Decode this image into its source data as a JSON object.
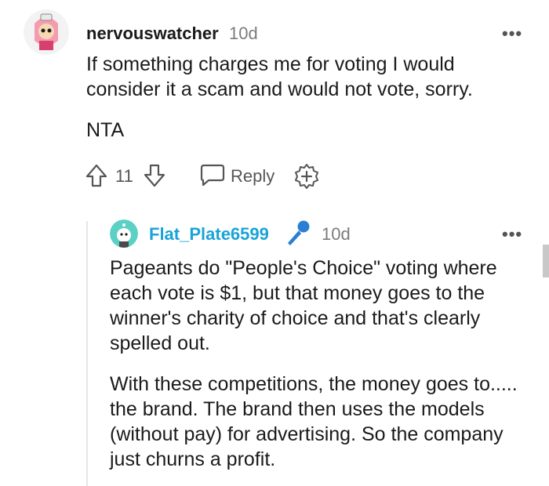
{
  "comment": {
    "username": "nervouswatcher",
    "time": "10d",
    "paragraphs": [
      "If something charges me for voting I would consider it a scam and would not vote, sorry.",
      "NTA"
    ],
    "votes": "11",
    "reply_label": "Reply",
    "more_label": "•••"
  },
  "reply": {
    "username": "Flat_Plate6599",
    "time": "10d",
    "paragraphs": [
      "Pageants do \"People's Choice\" voting where each vote is $1, but that money goes to the winner's charity of choice and that's clearly spelled out.",
      "With these competitions, the money goes to..... the brand. The brand then uses the models (without pay) for advertising. So the company just churns a profit."
    ],
    "more_label": "•••"
  },
  "colors": {
    "reply_username": "#1aa3d9",
    "mic_icon": "#2a7fd4",
    "avatar_teal": "#5bd0c4"
  }
}
